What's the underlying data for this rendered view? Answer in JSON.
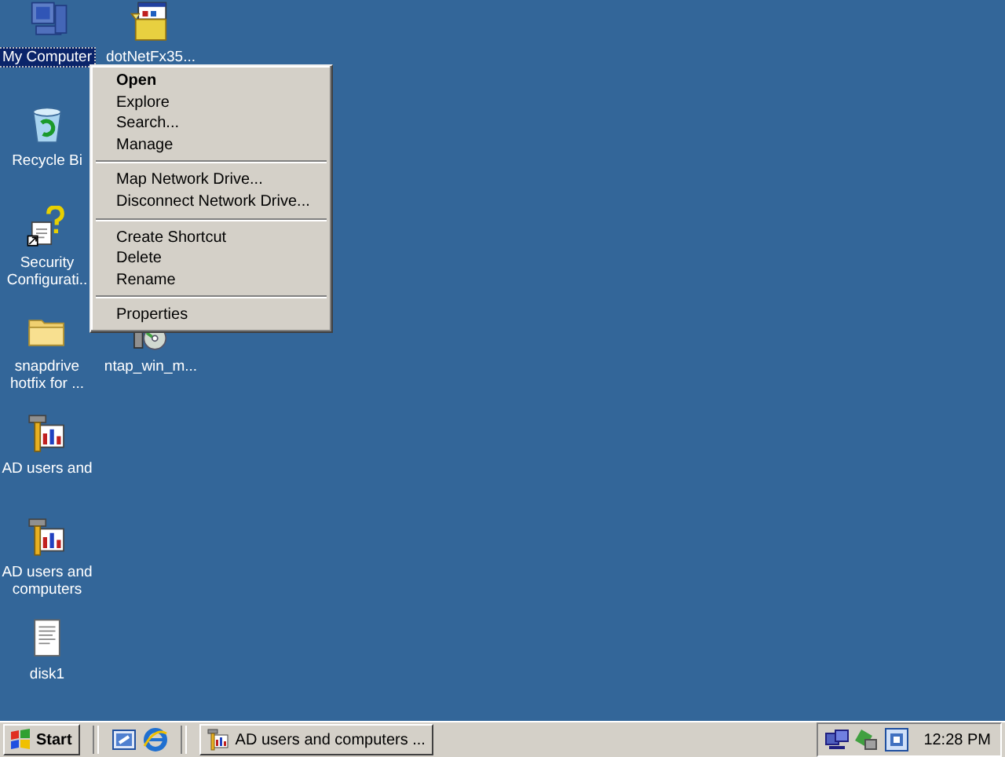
{
  "desktop_icons": [
    {
      "label": "My Computer",
      "kind": "computer",
      "selected": true
    },
    {
      "label": "Recycle Bi",
      "kind": "recycle",
      "selected": false
    },
    {
      "label": "Security Configurati..",
      "kind": "security",
      "selected": false
    },
    {
      "label": "snapdrive hotfix for ...",
      "kind": "folder",
      "selected": false
    },
    {
      "label": "AD users and",
      "kind": "tool",
      "selected": false
    },
    {
      "label": "AD users and computers",
      "kind": "tool",
      "selected": false
    },
    {
      "label": "disk1",
      "kind": "document",
      "selected": false
    },
    {
      "label": "dotNetFx35...",
      "kind": "installer",
      "selected": false
    },
    {
      "label": "ntap_win_m...",
      "kind": "setup",
      "selected": false
    }
  ],
  "context_menu": [
    {
      "kind": "item",
      "label": "Open",
      "default": true
    },
    {
      "kind": "item",
      "label": "Explore",
      "default": false
    },
    {
      "kind": "item",
      "label": "Search...",
      "default": false
    },
    {
      "kind": "item",
      "label": "Manage",
      "default": false
    },
    {
      "kind": "separator"
    },
    {
      "kind": "item",
      "label": "Map Network Drive...",
      "default": false
    },
    {
      "kind": "item",
      "label": "Disconnect Network Drive...",
      "default": false
    },
    {
      "kind": "separator"
    },
    {
      "kind": "item",
      "label": "Create Shortcut",
      "default": false
    },
    {
      "kind": "item",
      "label": "Delete",
      "default": false
    },
    {
      "kind": "item",
      "label": "Rename",
      "default": false
    },
    {
      "kind": "separator"
    },
    {
      "kind": "item",
      "label": "Properties",
      "default": false
    }
  ],
  "taskbar": {
    "start": "Start",
    "tasks": [
      {
        "label": "AD users and computers ...",
        "selected": false
      }
    ],
    "clock": "12:28 PM"
  }
}
